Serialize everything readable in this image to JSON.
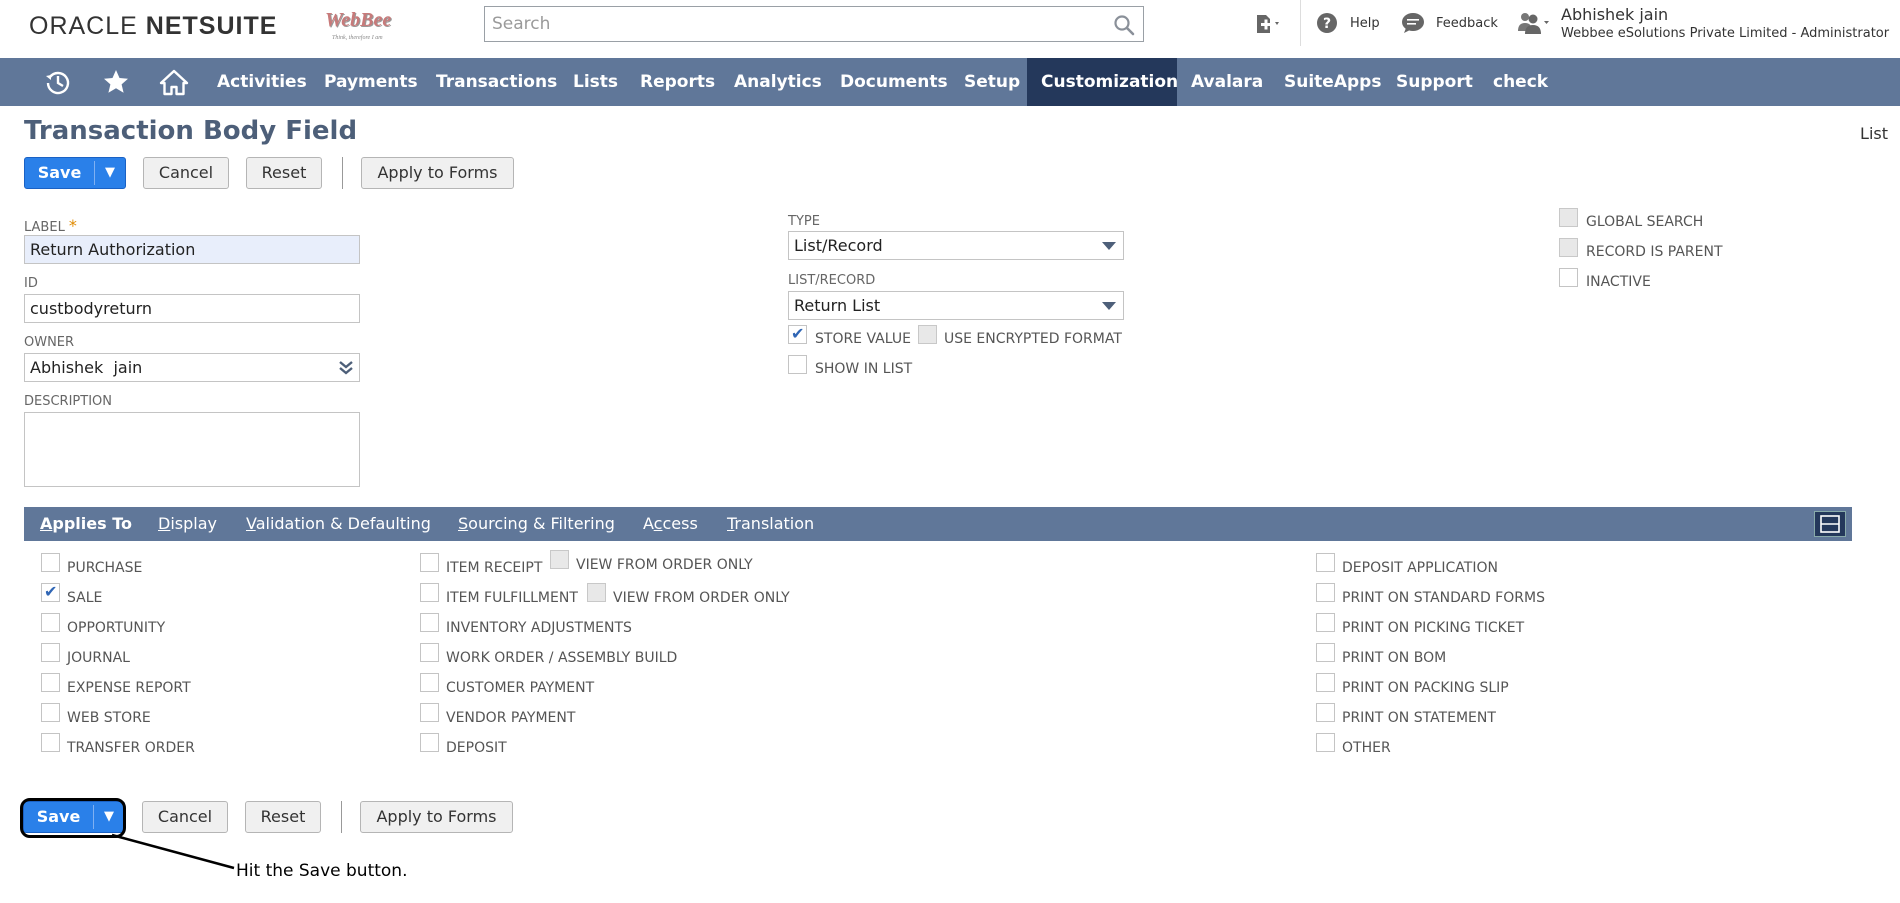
{
  "header": {
    "logo_left": "ORACLE",
    "logo_right": "NETSUITE",
    "partner_logo": {
      "name": "WebBee",
      "tagline": "Think, therefore I am"
    },
    "search_placeholder": "Search",
    "help_label": "Help",
    "feedback_label": "Feedback",
    "user_name": "Abhishek jain",
    "user_role": "Webbee eSolutions Private Limited - Administrator"
  },
  "nav": {
    "icons": [
      "recent-records-icon",
      "star-icon",
      "home-icon"
    ],
    "items": [
      {
        "label": "Activities",
        "active": false
      },
      {
        "label": "Payments",
        "active": false
      },
      {
        "label": "Transactions",
        "active": false
      },
      {
        "label": "Lists",
        "active": false
      },
      {
        "label": "Reports",
        "active": false
      },
      {
        "label": "Analytics",
        "active": false
      },
      {
        "label": "Documents",
        "active": false
      },
      {
        "label": "Setup",
        "active": false
      },
      {
        "label": "Customization",
        "active": true
      },
      {
        "label": "Avalara",
        "active": false
      },
      {
        "label": "SuiteApps",
        "active": false
      },
      {
        "label": "Support",
        "active": false
      },
      {
        "label": "check",
        "active": false
      }
    ]
  },
  "page": {
    "title": "Transaction Body Field",
    "list_link": "List"
  },
  "buttons": {
    "save": "Save",
    "save_arrow": "▼",
    "cancel": "Cancel",
    "reset": "Reset",
    "apply_to_forms": "Apply to Forms"
  },
  "form": {
    "label": {
      "label": "LABEL",
      "required": "*",
      "value": "Return Authorization"
    },
    "id": {
      "label": "ID",
      "value": "custbodyreturn"
    },
    "owner": {
      "label": "OWNER",
      "value": "Abhishek  jain"
    },
    "description": {
      "label": "DESCRIPTION",
      "value": ""
    },
    "type": {
      "label": "TYPE",
      "value": "List/Record"
    },
    "list_record": {
      "label": "LIST/RECORD",
      "value": "Return List"
    },
    "store_value": {
      "label": "STORE VALUE",
      "checked": true
    },
    "use_encrypted_format": {
      "label": "USE ENCRYPTED FORMAT",
      "checked": false,
      "disabled": true
    },
    "show_in_list": {
      "label": "SHOW IN LIST",
      "checked": false
    },
    "global_search": {
      "label": "GLOBAL SEARCH",
      "checked": false,
      "disabled": true
    },
    "record_is_parent": {
      "label": "RECORD IS PARENT",
      "checked": false,
      "disabled": true
    },
    "inactive": {
      "label": "INACTIVE",
      "checked": false
    }
  },
  "subtabs": [
    {
      "label": "Applies To",
      "underline": "A",
      "rest": "pplies To",
      "active": true
    },
    {
      "label": "Display",
      "underline": "D",
      "rest": "isplay",
      "active": false
    },
    {
      "label": "Validation & Defaulting",
      "underline": "V",
      "rest": "alidation & Defaulting",
      "active": false
    },
    {
      "label": "Sourcing & Filtering",
      "underline": "S",
      "rest": "ourcing & Filtering",
      "active": false
    },
    {
      "label": "Access",
      "pre": "A",
      "underline": "c",
      "rest": "cess",
      "active": false
    },
    {
      "label": "Translation",
      "underline": "T",
      "rest": "ranslation",
      "active": false
    }
  ],
  "applies_to": {
    "col1": [
      {
        "label": "PURCHASE",
        "checked": false
      },
      {
        "label": "SALE",
        "checked": true
      },
      {
        "label": "OPPORTUNITY",
        "checked": false
      },
      {
        "label": "JOURNAL",
        "checked": false
      },
      {
        "label": "EXPENSE REPORT",
        "checked": false
      },
      {
        "label": "WEB STORE",
        "checked": false
      },
      {
        "label": "TRANSFER ORDER",
        "checked": false
      }
    ],
    "col2": [
      {
        "label": "ITEM RECEIPT",
        "checked": false
      },
      {
        "label": "ITEM FULFILLMENT",
        "checked": false
      },
      {
        "label": "INVENTORY ADJUSTMENTS",
        "checked": false
      },
      {
        "label": "WORK ORDER / ASSEMBLY BUILD",
        "checked": false
      },
      {
        "label": "CUSTOMER PAYMENT",
        "checked": false
      },
      {
        "label": "VENDOR PAYMENT",
        "checked": false
      },
      {
        "label": "DEPOSIT",
        "checked": false
      }
    ],
    "view_from_order_only": [
      {
        "label": "VIEW FROM ORDER ONLY",
        "checked": false,
        "disabled": true
      },
      {
        "label": "VIEW FROM ORDER ONLY",
        "checked": false,
        "disabled": true
      }
    ],
    "col3": [
      {
        "label": "DEPOSIT APPLICATION",
        "checked": false
      },
      {
        "label": "PRINT ON STANDARD FORMS",
        "checked": false
      },
      {
        "label": "PRINT ON PICKING TICKET",
        "checked": false
      },
      {
        "label": "PRINT ON BOM",
        "checked": false
      },
      {
        "label": "PRINT ON PACKING SLIP",
        "checked": false
      },
      {
        "label": "PRINT ON STATEMENT",
        "checked": false
      },
      {
        "label": "OTHER",
        "checked": false
      }
    ]
  },
  "annotation": {
    "text": "Hit the Save button."
  },
  "colors": {
    "nav_bg": "#607799",
    "nav_active": "#24385b",
    "primary_button": "#2a80e9",
    "title": "#4d5f79"
  }
}
